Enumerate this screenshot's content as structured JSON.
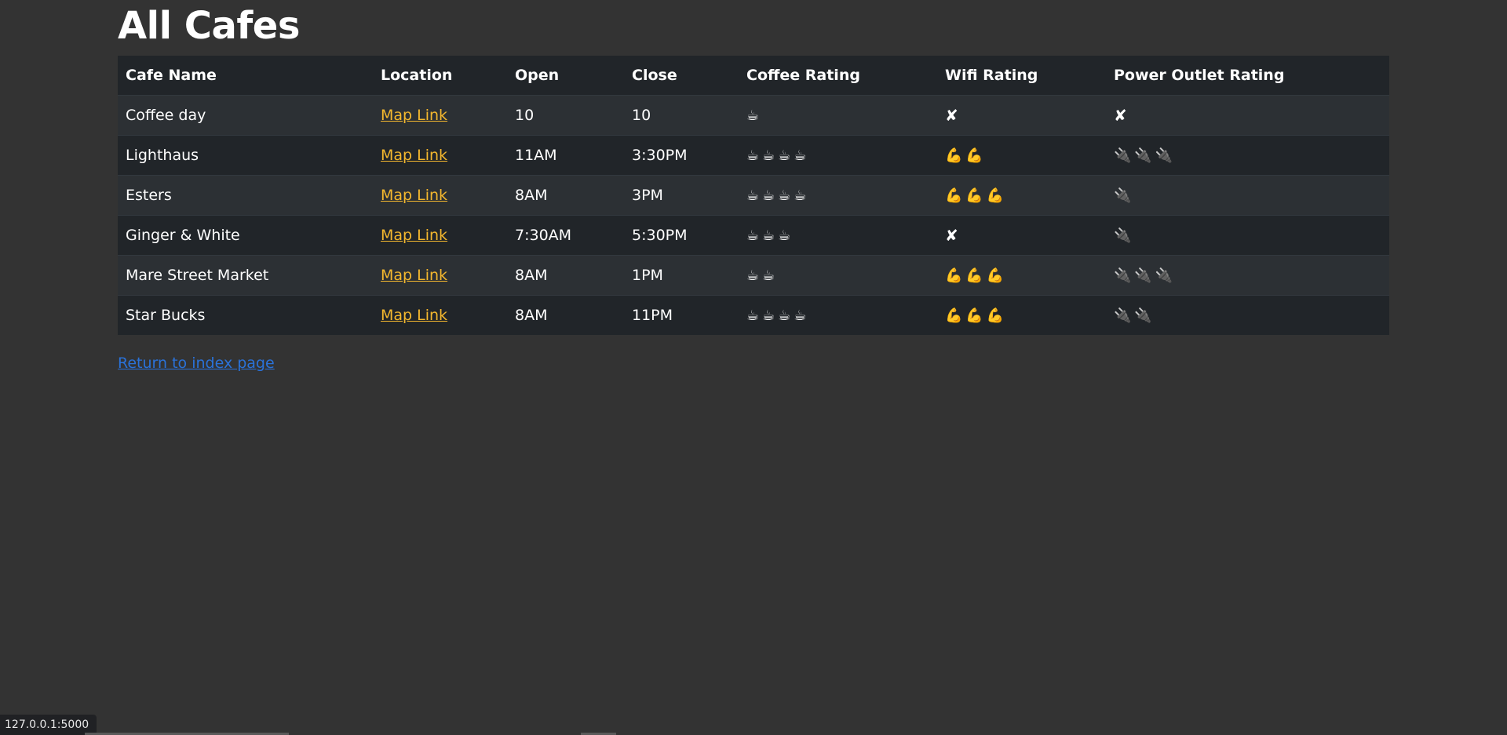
{
  "page": {
    "title": "All Cafes",
    "return_link": "Return to index page"
  },
  "table": {
    "headers": [
      "Cafe Name",
      "Location",
      "Open",
      "Close",
      "Coffee Rating",
      "Wifi Rating",
      "Power Outlet Rating"
    ],
    "rows": [
      {
        "name": "Coffee day",
        "location": "Map Link",
        "open": "10",
        "close": "10",
        "coffee": "☕",
        "wifi": "✘",
        "power": "✘"
      },
      {
        "name": "Lighthaus",
        "location": "Map Link",
        "open": "11AM",
        "close": "3:30PM",
        "coffee": "☕☕☕☕",
        "wifi": "💪💪",
        "power": "🔌🔌🔌"
      },
      {
        "name": "Esters",
        "location": "Map Link",
        "open": "8AM",
        "close": "3PM",
        "coffee": "☕☕☕☕",
        "wifi": "💪💪💪",
        "power": "🔌"
      },
      {
        "name": "Ginger & White",
        "location": "Map Link",
        "open": "7:30AM",
        "close": "5:30PM",
        "coffee": "☕☕☕",
        "wifi": "✘",
        "power": "🔌"
      },
      {
        "name": "Mare Street Market",
        "location": "Map Link",
        "open": "8AM",
        "close": "1PM",
        "coffee": "☕☕",
        "wifi": "💪💪💪",
        "power": "🔌🔌🔌"
      },
      {
        "name": "Star Bucks",
        "location": "Map Link",
        "open": "8AM",
        "close": "11PM",
        "coffee": "☕☕☕☕",
        "wifi": "💪💪💪",
        "power": "🔌🔌"
      }
    ]
  },
  "status_bar": {
    "url": "127.0.0.1:5000"
  },
  "colors": {
    "background": "#333333",
    "header_row": "#212529",
    "row_odd": "#2c3034",
    "row_even": "#212529",
    "map_link": "#f5b82e",
    "return_link": "#2a72d9"
  }
}
